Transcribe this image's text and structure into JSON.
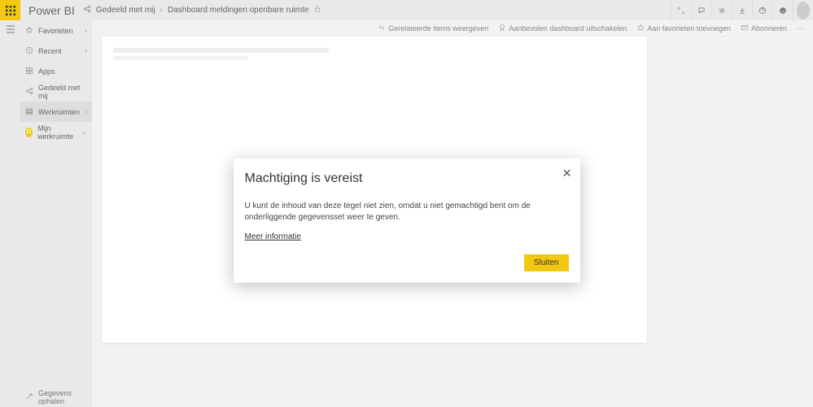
{
  "header": {
    "logo": "Power BI",
    "breadcrumb": {
      "level1": "Gedeeld met mij",
      "level2": "Dashboard meldingen openbare ruimte"
    }
  },
  "sidebar": {
    "items": [
      {
        "label": "Favorieten"
      },
      {
        "label": "Recent"
      },
      {
        "label": "Apps"
      },
      {
        "label": "Gedeeld met mij"
      },
      {
        "label": "Werkruimten"
      },
      {
        "label": "Mijn werkruimte"
      }
    ],
    "bottom": {
      "label": "Gegevens ophalen"
    }
  },
  "actionbar": {
    "related": "Gerelateerde items weergeven",
    "recommended": "Aanbevolen dashboard uitschakelen",
    "favorite": "Aan favorieten toevoegen",
    "subscribe": "Abonneren"
  },
  "modal": {
    "title": "Machtiging is vereist",
    "body": "U kunt de inhoud van deze tegel niet zien, omdat u niet gemachtigd bent om de onderliggende gegevensset weer te geven.",
    "link": "Meer informatie",
    "close_btn": "Sluiten"
  }
}
